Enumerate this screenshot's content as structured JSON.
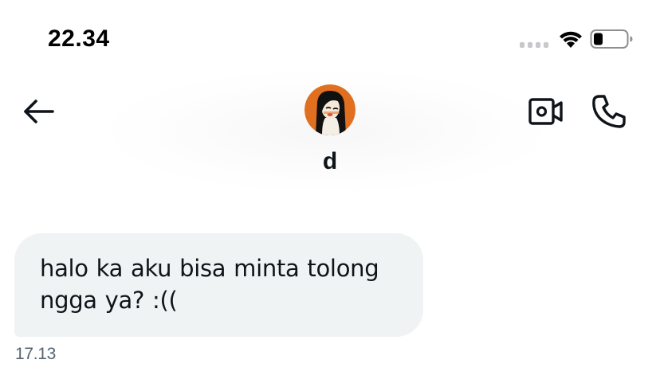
{
  "status_bar": {
    "time": "22.34",
    "battery_level": 0.25,
    "icons": [
      "signal-dots-icon",
      "wifi-icon",
      "battery-icon"
    ]
  },
  "header": {
    "contact_name": "d",
    "icons": {
      "back": "back-arrow-icon",
      "video_call": "video-camera-icon",
      "voice_call": "phone-icon"
    }
  },
  "messages": [
    {
      "text": "halo ka aku bisa minta tolong ngga ya? :((",
      "time": "17.13",
      "direction": "incoming"
    }
  ],
  "colors": {
    "accent_avatar": "#e07020",
    "bubble_background": "#eff3f4",
    "text_primary": "#0f1419",
    "text_secondary": "#536471"
  }
}
